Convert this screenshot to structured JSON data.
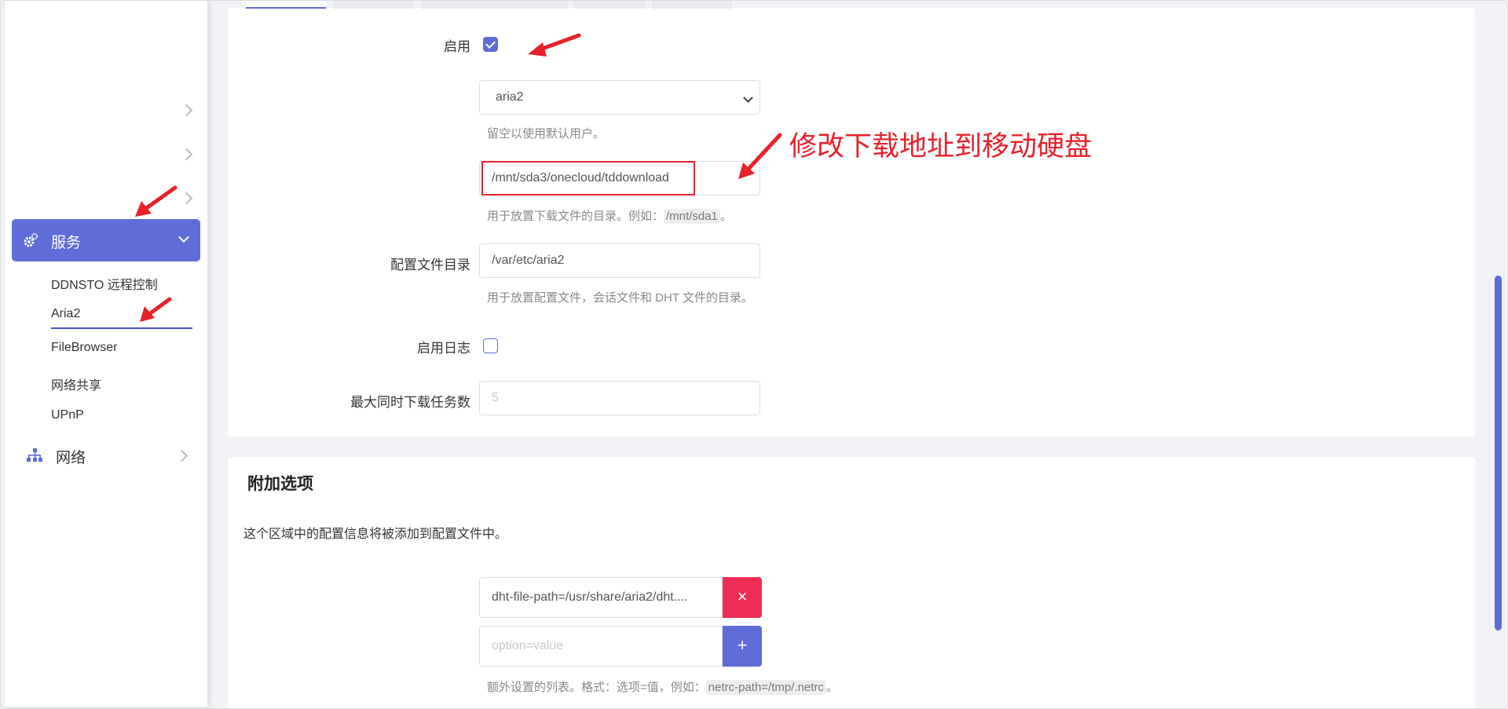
{
  "sidebar": {
    "services_label": "服务",
    "sub_items": [
      {
        "label": "DDNSTO 远程控制"
      },
      {
        "label": "Aria2"
      },
      {
        "label": "FileBrowser"
      },
      {
        "label": "网络共享"
      },
      {
        "label": "UPnP"
      }
    ],
    "active_item": "Aria2",
    "network_label": "网络"
  },
  "form": {
    "enable_label": "启用",
    "enable_checked": true,
    "user_select_value": "aria2",
    "user_hint": "留空以使用默认用户。",
    "download_dir_value": "/mnt/sda3/onecloud/tddownload",
    "download_dir_hint_prefix": "用于放置下载文件的目录。例如：",
    "download_dir_hint_code": "/mnt/sda1",
    "download_dir_hint_suffix": "。",
    "config_dir_label": "配置文件目录",
    "config_dir_value": "/var/etc/aria2",
    "config_dir_hint": "用于放置配置文件，会话文件和 DHT 文件的目录。",
    "log_label": "启用日志",
    "log_checked": false,
    "max_tasks_label": "最大同时下载任务数",
    "max_tasks_placeholder": "5"
  },
  "annotation": {
    "text": "修改下载地址到移动硬盘",
    "color": "#e8212b"
  },
  "extra": {
    "title": "附加选项",
    "description": "这个区域中的配置信息将被添加到配置文件中。",
    "item_value": "dht-file-path=/usr/share/aria2/dht....",
    "remove_symbol": "×",
    "new_placeholder": "option=value",
    "add_symbol": "+",
    "hint_prefix": "额外设置的列表。格式：选项=值，例如：",
    "hint_code": "netrc-path=/tmp/.netrc",
    "hint_suffix": "。"
  },
  "colors": {
    "accent": "#5e6dd8",
    "danger": "#ee2d55",
    "annotation": "#e8212b"
  }
}
